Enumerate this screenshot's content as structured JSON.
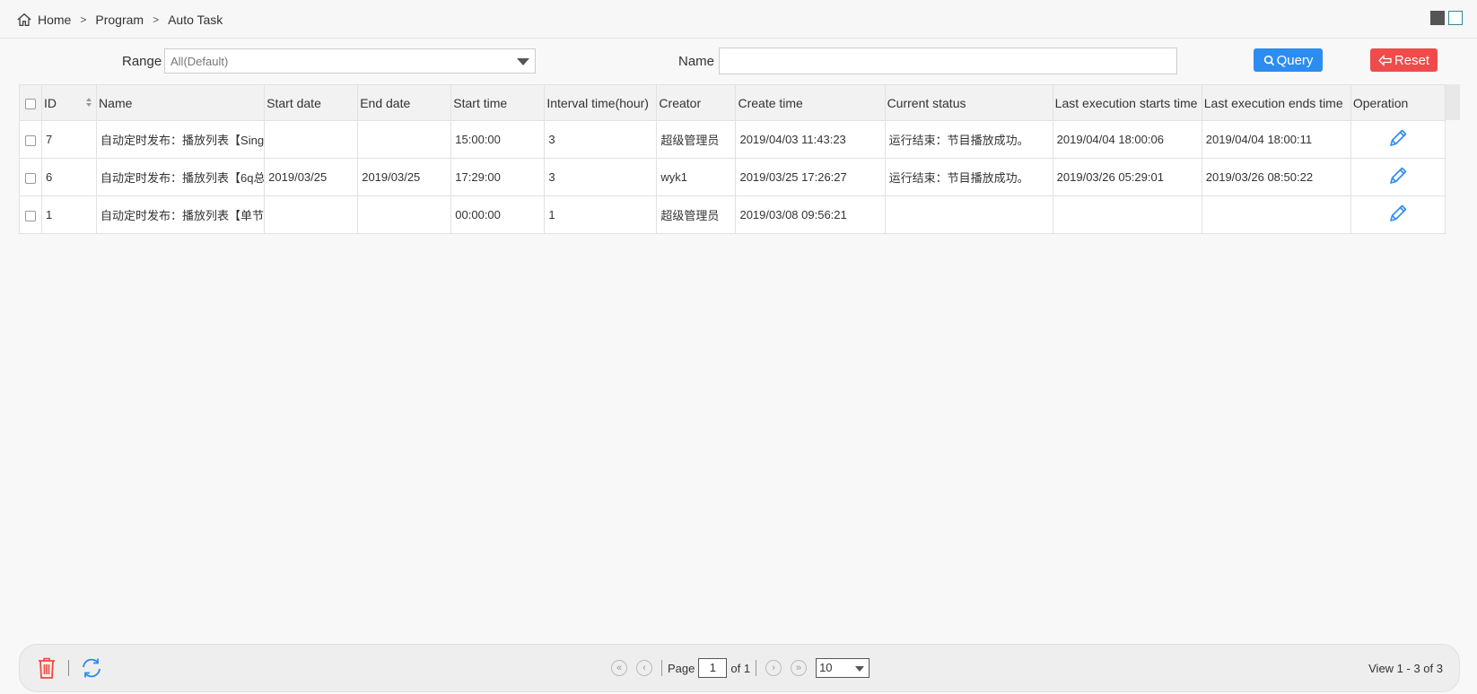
{
  "breadcrumb": {
    "home": "Home",
    "program": "Program",
    "current": "Auto Task"
  },
  "filters": {
    "range_label": "Range",
    "range_value": "All(Default)",
    "name_label": "Name",
    "name_value": "",
    "query_label": "Query",
    "reset_label": "Reset"
  },
  "table": {
    "headers": [
      "",
      "ID",
      "Name",
      "Start date",
      "End date",
      "Start time",
      "Interval time(hour)",
      "Creator",
      "Create time",
      "Current status",
      "Last execution starts time",
      "Last execution ends time",
      "Operation"
    ],
    "rows": [
      {
        "id": "7",
        "name": "自动定时发布：播放列表【Sing",
        "start_date": "",
        "end_date": "",
        "start_time": "15:00:00",
        "interval": "3",
        "creator": "超级管理员",
        "create_time": "2019/04/03 11:43:23",
        "status": "运行结束：节目播放成功。",
        "last_start": "2019/04/04 18:00:06",
        "last_end": "2019/04/04 18:00:11"
      },
      {
        "id": "6",
        "name": "自动定时发布：播放列表【6q总",
        "start_date": "2019/03/25",
        "end_date": "2019/03/25",
        "start_time": "17:29:00",
        "interval": "3",
        "creator": "wyk1",
        "create_time": "2019/03/25 17:26:27",
        "status": "运行结束：节目播放成功。",
        "last_start": "2019/03/26 05:29:01",
        "last_end": "2019/03/26 08:50:22"
      },
      {
        "id": "1",
        "name": "自动定时发布：播放列表【单节",
        "start_date": "",
        "end_date": "",
        "start_time": "00:00:00",
        "interval": "1",
        "creator": "超级管理员",
        "create_time": "2019/03/08 09:56:21",
        "status": "",
        "last_start": "",
        "last_end": ""
      }
    ]
  },
  "pager": {
    "page_label": "Page",
    "page_value": "1",
    "of_label": "of 1",
    "page_size": "10",
    "view_info": "View 1 - 3 of 3"
  },
  "colors": {
    "query": "#2d8cf0",
    "reset": "#ef4b4b",
    "edit_icon": "#2d8cf0",
    "delete_icon": "#e84c3d",
    "refresh_icon": "#2d8cf0"
  }
}
